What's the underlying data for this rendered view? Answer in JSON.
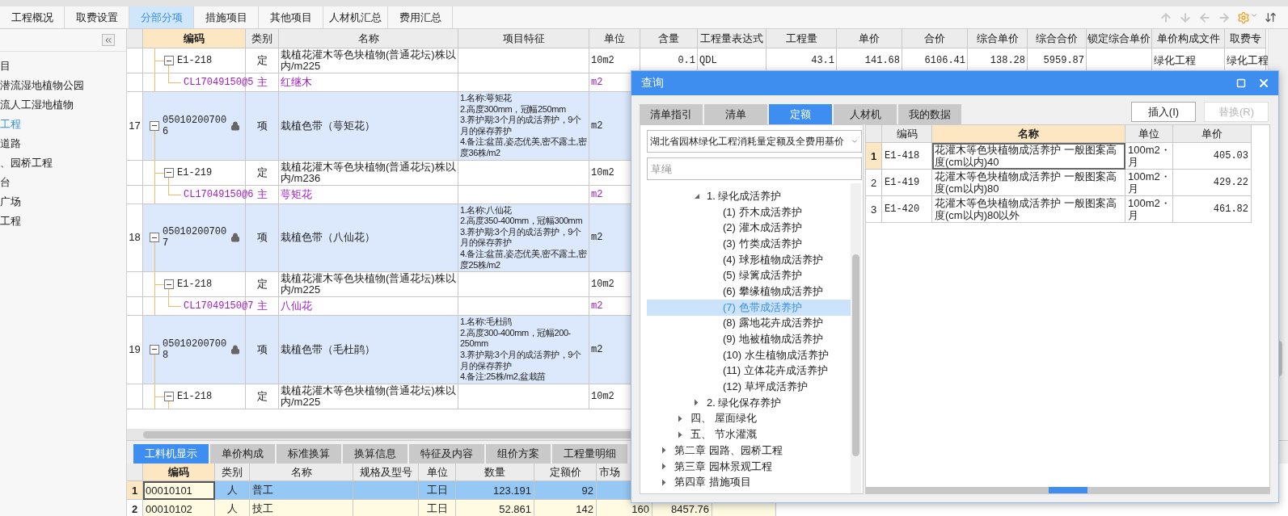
{
  "top_tabs": [
    {
      "label": "工程概况",
      "selected": false
    },
    {
      "label": "取费设置",
      "selected": false
    },
    {
      "label": "分部分项",
      "selected": true
    },
    {
      "label": "措施项目",
      "selected": false
    },
    {
      "label": "其他项目",
      "selected": false
    },
    {
      "label": "人材机汇总",
      "selected": false
    },
    {
      "label": "费用汇总",
      "selected": false
    }
  ],
  "sidebar": {
    "items": [
      {
        "label": "目",
        "selected": false
      },
      {
        "label": "潜流湿地植物公园",
        "selected": false
      },
      {
        "label": "流人工湿地植物",
        "selected": false
      },
      {
        "label": "工程",
        "selected": true
      },
      {
        "label": "道路",
        "selected": false
      },
      {
        "label": "、园桥工程",
        "selected": false
      },
      {
        "label": "台",
        "selected": false
      },
      {
        "label": "广场",
        "selected": false
      },
      {
        "label": "工程",
        "selected": false
      }
    ]
  },
  "table": {
    "columns": [
      "编码",
      "类别",
      "名称",
      "项目特征",
      "单位",
      "含量",
      "工程量表达式",
      "工程量",
      "单价",
      "合价",
      "综合单价",
      "综合合价",
      "锁定综合单价",
      "单价构成文件",
      "取费专"
    ],
    "rows": [
      {
        "kind": "quota",
        "expanded": true,
        "code": "E1-218",
        "type": "定",
        "name": "栽植花灌木等色块植物(普通花坛)株以内/m225",
        "unit": "10m2",
        "content": "0.1",
        "expression": "QDL",
        "quantity": "43.1",
        "unit_price": "141.68",
        "total": "6106.41",
        "composite_unit_price": "138.28",
        "composite_total": "5959.87",
        "pricing_file": "绿化工程",
        "fee_category": "绿化工程"
      },
      {
        "kind": "material",
        "code": "CL17049150@5",
        "type": "主",
        "name": "红继木",
        "unit": "m2"
      },
      {
        "kind": "item",
        "number": "17",
        "expanded": true,
        "locked": true,
        "code": "050102007006",
        "type": "项",
        "name": "栽植色带（萼矩花）",
        "features": [
          "1.名称:萼矩花",
          "2.高度300mm，冠幅250mm",
          "3.养护期:3个月的成活养护，9个月的保存养护",
          "4.备注:盆苗,姿态优美,密不露土,密度36株/m2"
        ],
        "unit": "m2"
      },
      {
        "kind": "quota",
        "expanded": true,
        "code": "E1-219",
        "type": "定",
        "name": "栽植花灌木等色块植物(普通花坛)株以内/m236",
        "unit": "10m2"
      },
      {
        "kind": "material",
        "code": "CL17049150@6",
        "type": "主",
        "name": "萼矩花",
        "unit": "m2"
      },
      {
        "kind": "item",
        "number": "18",
        "expanded": true,
        "locked": true,
        "code": "050102007007",
        "type": "项",
        "name": "栽植色带（八仙花）",
        "features": [
          "1.名称:八仙花",
          "2.高度350-400mm，冠幅300mm",
          "3.养护期:3个月的成活养护，9个月的保存养护",
          "4.备注:盆苗,姿态优美,密不露土,密度25株/m2"
        ],
        "unit": "m2"
      },
      {
        "kind": "quota",
        "expanded": true,
        "code": "E1-218",
        "type": "定",
        "name": "栽植花灌木等色块植物(普通花坛)株以内/m225",
        "unit": "10m2"
      },
      {
        "kind": "material",
        "code": "CL17049150@7",
        "type": "主",
        "name": "八仙花",
        "unit": "m2"
      },
      {
        "kind": "item",
        "number": "19",
        "expanded": true,
        "locked": true,
        "code": "050102007008",
        "type": "项",
        "name": "栽植色带（毛杜鹃）",
        "features": [
          "1.名称:毛杜鹃",
          "2.高度300-400mm，冠幅200-250mm",
          "3.养护期:3个月的成活养护，9个月的保存养护",
          "4.备注:25株/m2,盆栽苗"
        ],
        "unit": "m2"
      },
      {
        "kind": "quota",
        "expanded": true,
        "code": "E1-218",
        "type": "定",
        "name": "栽植花灌木等色块植物(普通花坛)株以内/m225",
        "unit": "10m2"
      }
    ]
  },
  "bottom": {
    "tabs": [
      {
        "label": "工料机显示",
        "selected": true
      },
      {
        "label": "单价构成",
        "selected": false
      },
      {
        "label": "标准换算",
        "selected": false
      },
      {
        "label": "换算信息",
        "selected": false
      },
      {
        "label": "特征及内容",
        "selected": false
      },
      {
        "label": "组价方案",
        "selected": false
      },
      {
        "label": "工程量明细",
        "selected": false
      }
    ],
    "columns": [
      "编码",
      "类别",
      "名称",
      "规格及型号",
      "单位",
      "数量",
      "定额价",
      "市场"
    ],
    "rows": [
      {
        "number": "1",
        "selected": true,
        "code": "00010101",
        "type": "人",
        "name": "普工",
        "unit": "工日",
        "quantity": "123.191",
        "quota_price": "92"
      },
      {
        "number": "2",
        "selected": false,
        "code": "00010102",
        "type": "人",
        "name": "技工",
        "unit": "工日",
        "quantity": "52.861",
        "quota_price": "142",
        "market_price": "160",
        "column_10": "8457.76"
      }
    ]
  },
  "dialog": {
    "title": "查询",
    "tabs": [
      {
        "label": "清单指引",
        "selected": false
      },
      {
        "label": "清单",
        "selected": false
      },
      {
        "label": "定额",
        "selected": true
      },
      {
        "label": "人材机",
        "selected": false
      },
      {
        "label": "我的数据",
        "selected": false
      }
    ],
    "buttons": [
      {
        "label": "插入(I)",
        "disabled": false
      },
      {
        "label": "替换(R)",
        "disabled": true
      }
    ],
    "library": {
      "value": "湖北省园林绿化工程消耗量定额及全费用基价"
    },
    "search": {
      "placeholder": "草绳"
    },
    "tree": [
      {
        "children": [
          {
            "children": [
              {
                "label": "1. 绿化成活养护",
                "expanded": true,
                "children": [
                  {
                    "label": "(1) 乔木成活养护",
                    "selected": false
                  },
                  {
                    "label": "(2) 灌木成活养护",
                    "selected": false
                  },
                  {
                    "label": "(3) 竹类成活养护",
                    "selected": false
                  },
                  {
                    "label": "(4) 球形植物成活养护",
                    "selected": false
                  },
                  {
                    "label": "(5) 绿篱成活养护",
                    "selected": false
                  },
                  {
                    "label": "(6) 攀缘植物成活养护",
                    "selected": false
                  },
                  {
                    "label": "(7) 色带成活养护",
                    "selected": true
                  },
                  {
                    "label": "(8) 露地花卉成活养护",
                    "selected": false
                  },
                  {
                    "label": "(9) 地被植物成活养护",
                    "selected": false
                  },
                  {
                    "label": "(10) 水生植物成活养护",
                    "selected": false
                  },
                  {
                    "label": "(11) 立体花卉成活养护",
                    "selected": false
                  },
                  {
                    "label": "(12) 草坪成活养护",
                    "selected": false
                  }
                ]
              },
              {
                "label": "2. 绿化保存养护",
                "expanded": false
              }
            ]
          },
          {
            "label": "四、 屋面绿化",
            "expanded": false
          },
          {
            "label": "五、 节水灌溉",
            "expanded": false
          }
        ]
      },
      {
        "label": "第二章 园路、园桥工程",
        "expanded": false
      },
      {
        "label": "第三章 园林景观工程",
        "expanded": false
      },
      {
        "label": "第四章 措施项目",
        "expanded": false
      }
    ],
    "results": {
      "columns": [
        "编码",
        "名称",
        "单位",
        "单价"
      ],
      "rows": [
        {
          "number": "1",
          "selected": true,
          "code": "E1-418",
          "name": "花灌木等色块植物成活养护 一般图案高度(cm以内)40",
          "unit": "100m2・月",
          "price": "405.03"
        },
        {
          "number": "2",
          "selected": false,
          "code": "E1-419",
          "name": "花灌木等色块植物成活养护 一般图案高度(cm以内)80",
          "unit": "100m2・月",
          "price": "429.22"
        },
        {
          "number": "3",
          "selected": false,
          "code": "E1-420",
          "name": "花灌木等色块植物成活养护 一般图案高度(cm以内)80以外",
          "unit": "100m2・月",
          "price": "461.82"
        }
      ]
    }
  }
}
